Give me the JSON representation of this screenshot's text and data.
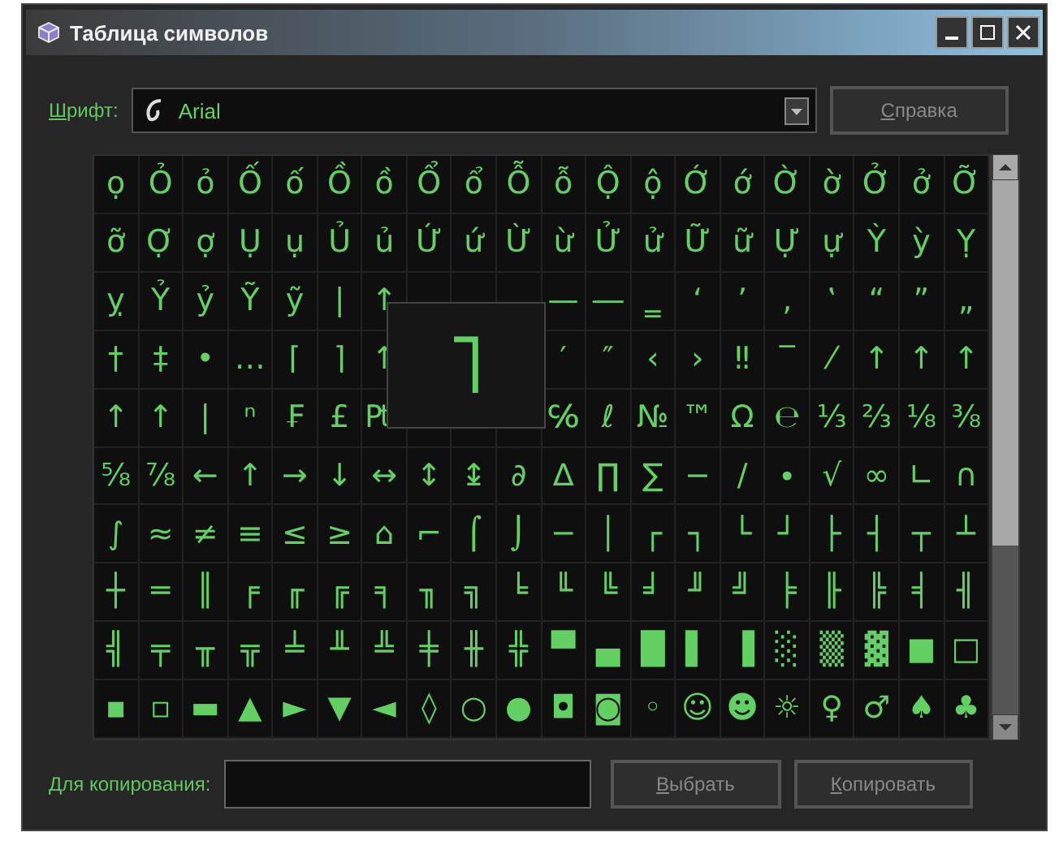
{
  "window": {
    "title": "Таблица символов"
  },
  "font": {
    "label": "Шрифт:",
    "value": "Arial"
  },
  "help_button": "Справка",
  "grid": {
    "rows": [
      [
        "ọ",
        "Ỏ",
        "ỏ",
        "Ố",
        "ố",
        "Ồ",
        "ồ",
        "Ổ",
        "ổ",
        "Ỗ",
        "ỗ",
        "Ộ",
        "ộ",
        "Ớ",
        "ớ",
        "Ờ",
        "ờ",
        "Ở",
        "ở",
        "Ỡ"
      ],
      [
        "ỡ",
        "Ợ",
        "ợ",
        "Ụ",
        "ụ",
        "Ủ",
        "ủ",
        "Ứ",
        "ứ",
        "Ừ",
        "ừ",
        "Ử",
        "ử",
        "Ữ",
        "ữ",
        "Ự",
        "ự",
        "Ỳ",
        "ỳ",
        "Ỵ"
      ],
      [
        "ỵ",
        "Ỷ",
        "ỷ",
        "Ỹ",
        "ỹ",
        "|",
        "↑",
        null,
        null,
        null,
        "—",
        "―",
        "‗",
        "‘",
        "’",
        "‚",
        "‛",
        "“",
        "”",
        "„"
      ],
      [
        "†",
        "‡",
        "•",
        "…",
        "⌈",
        "⌉",
        "↑",
        null,
        null,
        null,
        "′",
        "″",
        "‹",
        "›",
        "‼",
        "‾",
        "⁄",
        "↑",
        "↑",
        "↑"
      ],
      [
        "↑",
        "↑",
        "|",
        "ⁿ",
        "₣",
        "£",
        "₧",
        null,
        null,
        null,
        "℅",
        "ℓ",
        "№",
        "™",
        "Ω",
        "℮",
        "⅓",
        "⅔",
        "⅛",
        "⅜"
      ],
      [
        "⅝",
        "⅞",
        "←",
        "↑",
        "→",
        "↓",
        "↔",
        "↕",
        "↨",
        "∂",
        "∆",
        "∏",
        "∑",
        "−",
        "∕",
        "∙",
        "√",
        "∞",
        "∟",
        "∩"
      ],
      [
        "∫",
        "≈",
        "≠",
        "≡",
        "≤",
        "≥",
        "⌂",
        "⌐",
        "⌠",
        "⌡",
        "─",
        "│",
        "┌",
        "┐",
        "└",
        "┘",
        "├",
        "┤",
        "┬",
        "┴"
      ],
      [
        "┼",
        "═",
        "║",
        "╒",
        "╓",
        "╔",
        "╕",
        "╖",
        "╗",
        "╘",
        "╙",
        "╚",
        "╛",
        "╜",
        "╝",
        "╞",
        "╟",
        "╠",
        "╡",
        "╢"
      ],
      [
        "╣",
        "╤",
        "╥",
        "╦",
        "╧",
        "╨",
        "╩",
        "╪",
        "╫",
        "╬",
        "▀",
        "▄",
        "█",
        "▌",
        "▐",
        "░",
        "▒",
        "▓",
        "■",
        "□"
      ],
      [
        "▪",
        "▫",
        "▬",
        "▲",
        "►",
        "▼",
        "◄",
        "◊",
        "○",
        "●",
        "◘",
        "◙",
        "◦",
        "☺",
        "☻",
        "☼",
        "♀",
        "♂",
        "♠",
        "♣"
      ]
    ]
  },
  "magnified": {
    "char": "˥"
  },
  "copy": {
    "label": "Для копирования:"
  },
  "buttons": [
    "Выбрать",
    "Копировать"
  ]
}
